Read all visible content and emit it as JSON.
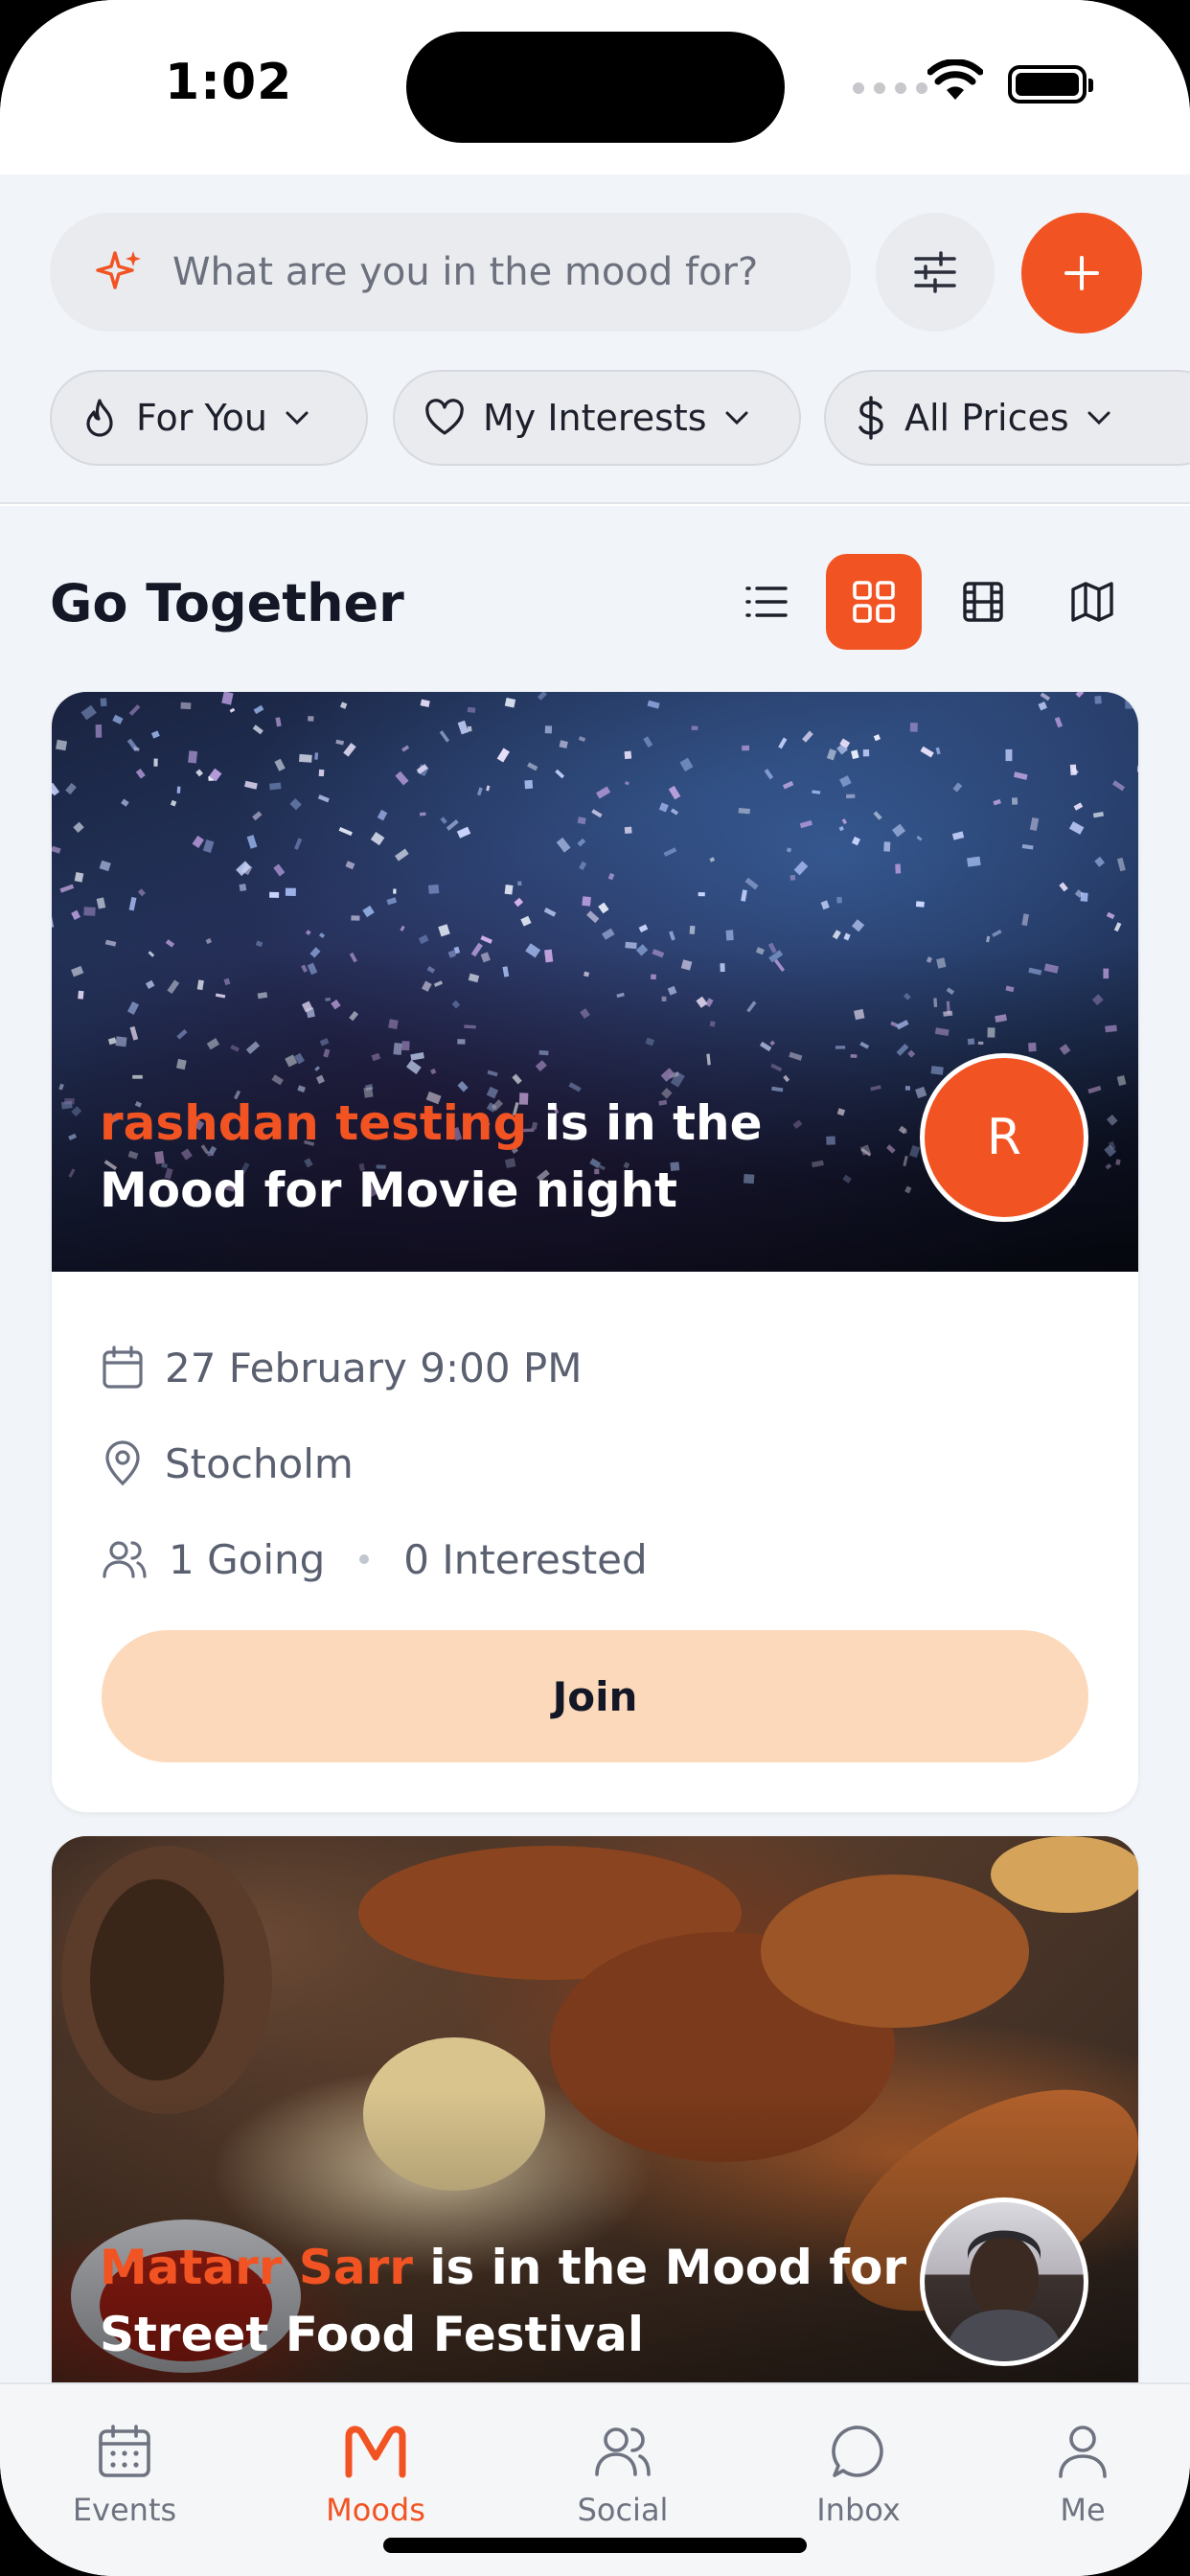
{
  "status_bar": {
    "time": "1:02"
  },
  "search": {
    "placeholder": "What are you in the mood for?"
  },
  "filters": [
    {
      "icon": "flame-icon",
      "label": "For You"
    },
    {
      "icon": "heart-icon",
      "label": "My Interests"
    },
    {
      "icon": "dollar-icon",
      "label": "All Prices"
    }
  ],
  "section": {
    "title": "Go Together",
    "views": [
      "list",
      "grid",
      "film",
      "map"
    ],
    "active_view": "grid"
  },
  "cards": [
    {
      "user_name": "rashdan testing",
      "mood_text": " is in the Mood for Movie night",
      "avatar_initial": "R",
      "date": "27 February 9:00 PM",
      "location": "Stocholm",
      "going": "1 Going",
      "interested": "0 Interested",
      "button": "Join"
    },
    {
      "user_name": "Matarr Sarr",
      "mood_text": " is in the Mood for Street Food Festival"
    }
  ],
  "tabs": [
    {
      "label": "Events",
      "icon": "calendar-icon"
    },
    {
      "label": "Moods",
      "icon": "moods-logo-icon",
      "active": true
    },
    {
      "label": "Social",
      "icon": "users-icon"
    },
    {
      "label": "Inbox",
      "icon": "chat-icon"
    },
    {
      "label": "Me",
      "icon": "profile-icon"
    }
  ],
  "colors": {
    "accent": "#f25322",
    "join_button": "#fdd9bb",
    "background": "#f1f4f8"
  }
}
